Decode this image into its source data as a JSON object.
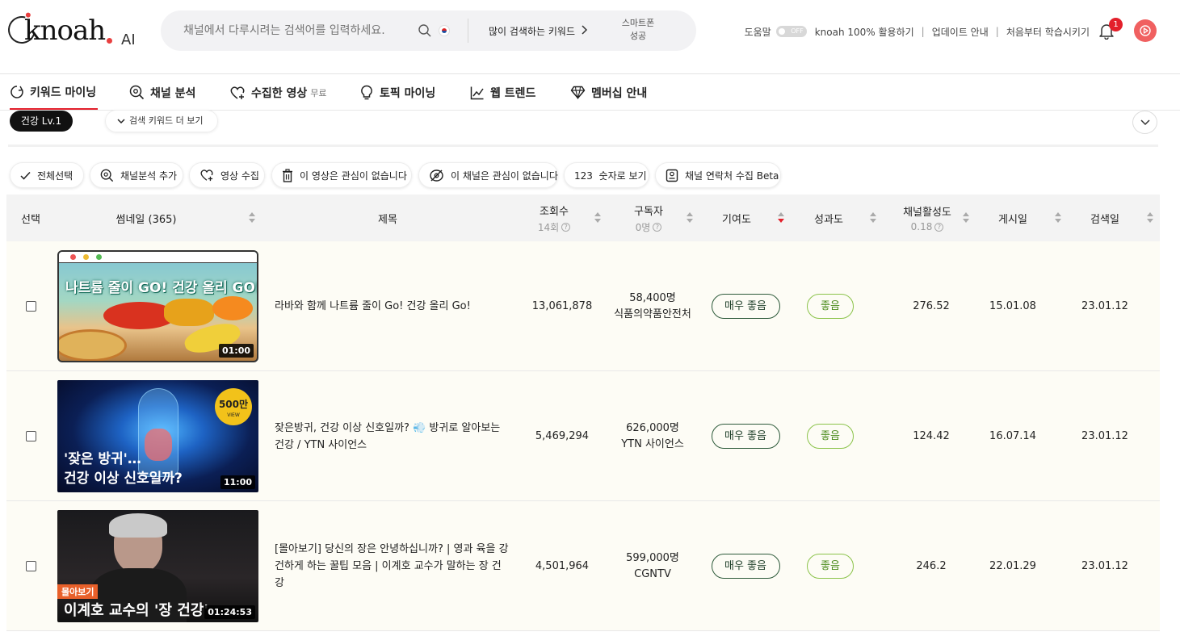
{
  "brand": {
    "logo_text": "knoah",
    "logo_suffix": "AI"
  },
  "search": {
    "placeholder": "채널에서 다루시려는 검색어를 입력하세요.",
    "popular_label": "많이 검색하는 키워드",
    "rolling_text": "스마트폰 성공"
  },
  "top_links": {
    "help_label": "도움말",
    "help_toggle": "OFF",
    "guide": "knoah 100% 활용하기",
    "updates": "업데이트 안내",
    "tutorial": "처음부터 학습시키기",
    "notifications_count": "1"
  },
  "nav": [
    {
      "label": "키워드 마이닝",
      "icon": "keyword-icon"
    },
    {
      "label": "채널 분석",
      "icon": "channel-analysis-icon"
    },
    {
      "label": "수집한 영상",
      "badge": "무료",
      "icon": "heart-plus-icon"
    },
    {
      "label": "토픽 마이닝",
      "icon": "lightbulb-icon"
    },
    {
      "label": "웹 트렌드",
      "icon": "trend-chart-icon"
    },
    {
      "label": "멤버십 안내",
      "icon": "diamond-icon"
    }
  ],
  "filter": {
    "tag": "건강 Lv.1",
    "more_keywords": "검색 키워드 더 보기"
  },
  "actions": [
    "전체선택",
    "채널분석 추가",
    "영상 수집",
    "이 영상은 관심이 없습니다",
    "이 채널은 관심이 없습니다",
    "123  숫자로 보기",
    "채널 연락처 수집 Beta"
  ],
  "columns": {
    "select": "선택",
    "thumbnail": "썸네일 (365)",
    "title": "제목",
    "views": "조회수",
    "views_sub": "14회",
    "subscribers": "구독자",
    "subscribers_sub": "0명",
    "contribution": "기여도",
    "performance": "성과도",
    "activity": "채널활성도",
    "activity_sub": "0.18",
    "posted": "게시일",
    "searched": "검색일"
  },
  "rows": [
    {
      "title": "라바와 함께 나트륨 줄이 Go! 건강 올리 Go!",
      "duration": "01:00",
      "thumb_text": "나트륨 줄이 GO! 건강 올리 GO!",
      "views": "13,061,878",
      "subscribers": "58,400명",
      "channel": "식품의약품안전처",
      "contribution": "매우 좋음",
      "performance": "좋음",
      "activity": "276.52",
      "posted": "15.01.08",
      "searched": "23.01.12"
    },
    {
      "title": "잦은방귀, 건강 이상 신호일까? 💨 방귀로 알아보는 건강 / YTN 사이언스",
      "duration": "11:00",
      "thumb_line1": "'잦은 방귀'…",
      "thumb_line2": "건강 이상 신호일까?",
      "thumb_badge": "500만",
      "thumb_badge_sub": "VIEW",
      "views": "5,469,294",
      "subscribers": "626,000명",
      "channel": "YTN 사이언스",
      "contribution": "매우 좋음",
      "performance": "좋음",
      "activity": "124.42",
      "posted": "16.07.14",
      "searched": "23.01.12"
    },
    {
      "title": "[몰아보기] 당신의 장은 안녕하십니까? | 영과 육을 강건하게 하는 꿀팁 모음 | 이계호 교수가 말하는 장 건강",
      "duration": "01:24:53",
      "thumb_tag": "몰아보기",
      "thumb_line": "이계호 교수의 '장 건강'",
      "views": "4,501,964",
      "subscribers": "599,000명",
      "channel": "CGNTV",
      "contribution": "매우 좋음",
      "performance": "좋음",
      "activity": "246.2",
      "posted": "22.01.29",
      "searched": "23.01.12"
    }
  ]
}
